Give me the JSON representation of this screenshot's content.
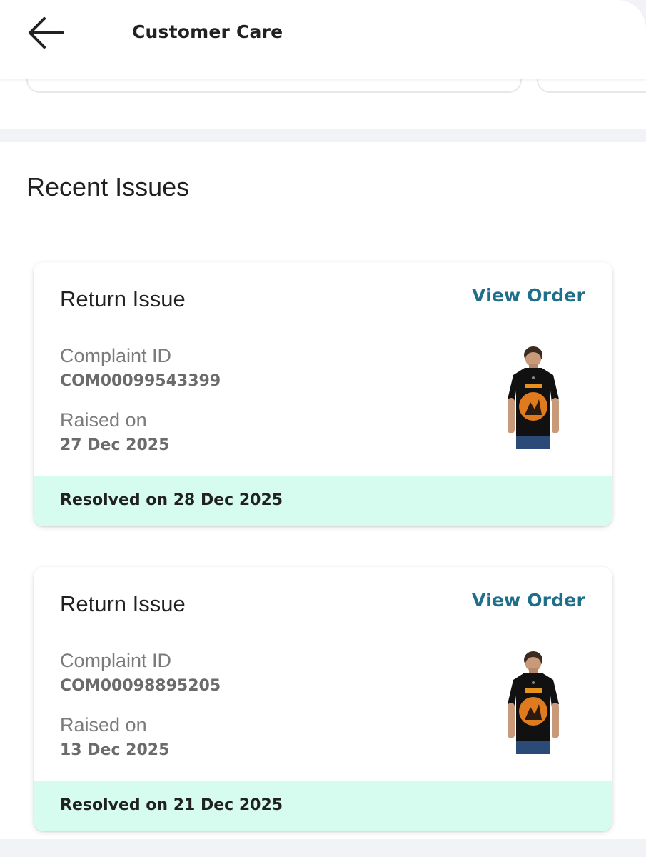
{
  "header": {
    "title": "Customer Care",
    "back_icon": "arrow-left-icon"
  },
  "recent_issues": {
    "title": "Recent Issues",
    "items": [
      {
        "type": "Return Issue",
        "action_label": "View Order",
        "complaint_label": "Complaint ID",
        "complaint_id": "COM00099543399",
        "raised_label": "Raised on",
        "raised_date": "27 Dec 2025",
        "resolved_text": "Resolved on 28 Dec 2025",
        "thumbnail_icon": "tshirt-product-image"
      },
      {
        "type": "Return Issue",
        "action_label": "View Order",
        "complaint_label": "Complaint ID",
        "complaint_id": "COM00098895205",
        "raised_label": "Raised on",
        "raised_date": "13 Dec 2025",
        "resolved_text": "Resolved on 21 Dec 2025",
        "thumbnail_icon": "tshirt-product-image"
      }
    ]
  },
  "colors": {
    "accent_link": "#1f6f8b",
    "resolved_bg": "#d6fbef",
    "divider_bg": "#f1f3f6"
  }
}
